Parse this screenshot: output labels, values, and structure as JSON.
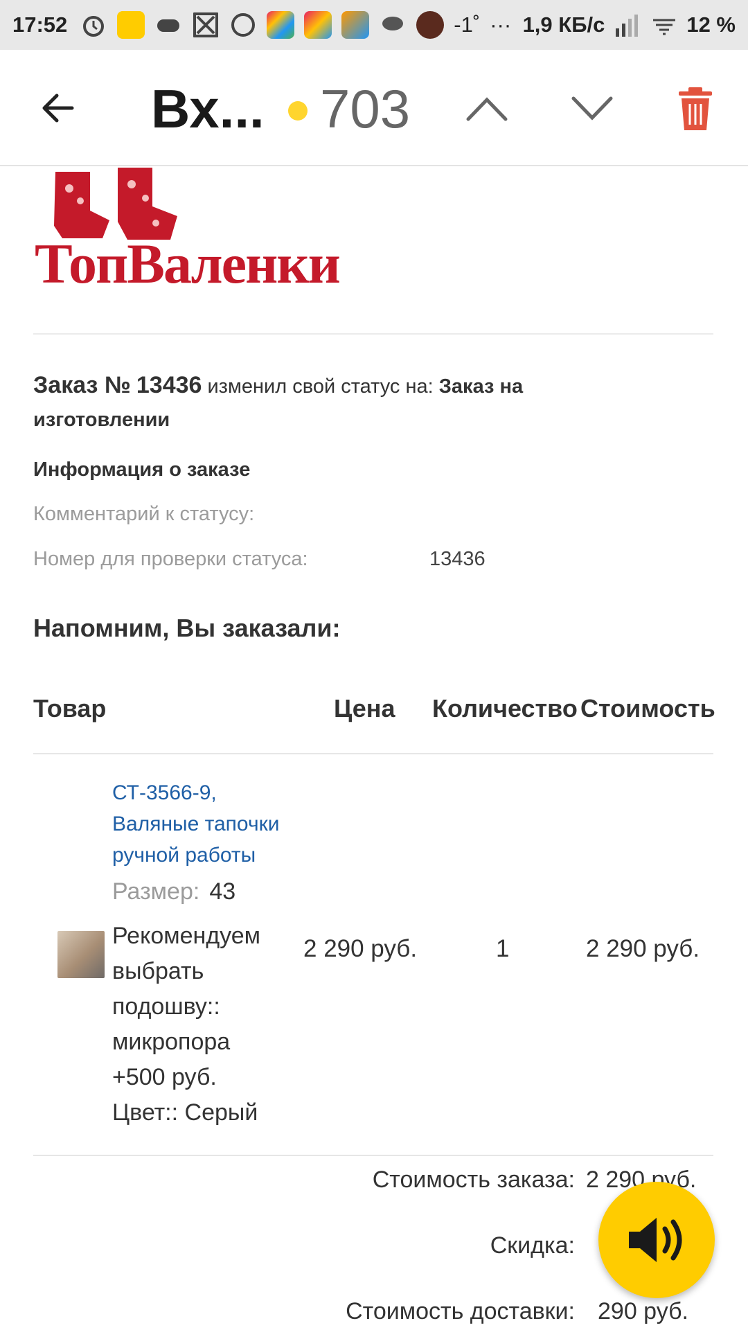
{
  "status_bar": {
    "time": "17:52",
    "weather": "-1˚",
    "more": "···",
    "net_speed": "1,9 КБ/с",
    "battery": "12 %"
  },
  "app_bar": {
    "title": "Вх...",
    "unread_count": "703",
    "colors": {
      "dot": "#ffd52e",
      "trash": "#e2533e"
    }
  },
  "email": {
    "brand": "ТопВаленки",
    "order_label": "Заказ №",
    "order_number": "13436",
    "changed_status_text": "изменил свой статус на:",
    "new_status": "Заказ на изготовлении",
    "info_heading": "Информация о заказе",
    "status_comment_label": "Комментарий к статусу:",
    "check_number_label": "Номер для проверки статуса:",
    "check_number_value": "13436",
    "reminder_heading": "Напомним, Вы заказали:",
    "table": {
      "headers": [
        "Товар",
        "Цена",
        "Количество",
        "Стоимость"
      ],
      "rows": [
        {
          "link_lines": [
            "СТ-3566-9,",
            "Валяные тапочки",
            "ручной работы"
          ],
          "size_label": "Размер:",
          "size_value": "43",
          "option_lines": [
            "Рекомендуем",
            "выбрать",
            "подошву::",
            "микропора",
            "+500 руб.",
            "Цвет:: Серый"
          ],
          "price": "2 290 руб.",
          "quantity": "1",
          "cost": "2 290 руб."
        }
      ]
    },
    "summary": {
      "order_cost_label": "Стоимость заказа:",
      "order_cost_value": "2 290 руб.",
      "discount_label": "Скидка:",
      "delivery_label": "Стоимость доставки:",
      "delivery_value": "290 руб."
    }
  },
  "fab": {
    "icon": "speaker-icon",
    "color": "#ffcc00"
  }
}
